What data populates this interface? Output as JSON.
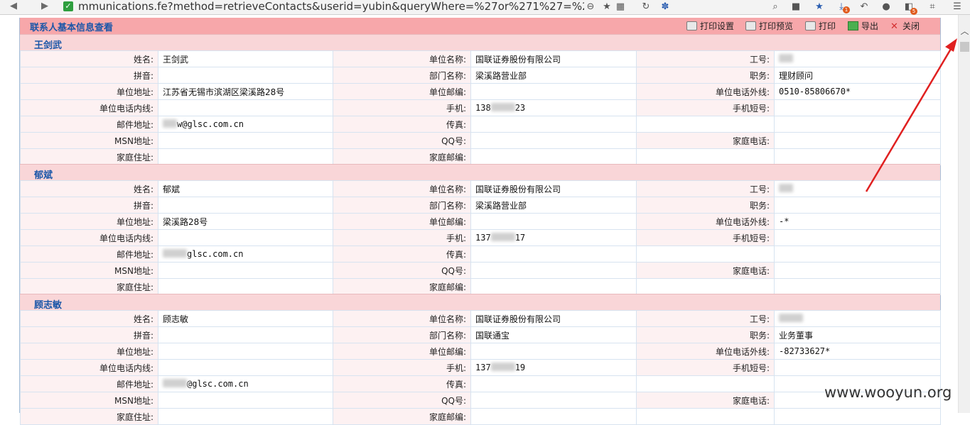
{
  "browser": {
    "url": "mmunications.fe?method=retrieveContacts&userid=yubin&queryWhere=%27or%271%27=%271",
    "badges": {
      "downloads": "1",
      "extension": "5"
    }
  },
  "panel": {
    "title": "联系人基本信息查看",
    "buttons": {
      "print_settings": "打印设置",
      "print_preview": "打印预览",
      "print": "打印",
      "export": "导出",
      "close": "关闭"
    }
  },
  "labels": {
    "name": "姓名:",
    "unit_name": "单位名称:",
    "job_no": "工号:",
    "pinyin": "拼音:",
    "dept": "部门名称:",
    "position": "职务:",
    "unit_addr": "单位地址:",
    "unit_zip": "单位邮编:",
    "unit_ext_phone": "单位电话外线:",
    "unit_int_phone": "单位电话内线:",
    "mobile": "手机:",
    "mobile_short": "手机短号:",
    "email": "邮件地址:",
    "fax": "传真:",
    "msn": "MSN地址:",
    "qq": "QQ号:",
    "home_phone": "家庭电话:",
    "home_addr": "家庭住址:",
    "home_zip": "家庭邮编:"
  },
  "contacts": [
    {
      "section": "王剑武",
      "name": "王剑武",
      "unit_name": "国联证券股份有限公司",
      "dept": "梁溪路营业部",
      "position": "理财顾问",
      "unit_addr": "江苏省无锡市滨湖区梁溪路28号",
      "unit_ext_phone": "0510-85806670*",
      "mobile_a": "138",
      "mobile_b": "23",
      "email_suffix": "w@glsc.com.cn"
    },
    {
      "section": "郁斌",
      "name": "郁斌",
      "unit_name": "国联证券股份有限公司",
      "dept": "梁溪路营业部",
      "position": "",
      "unit_addr": "梁溪路28号",
      "unit_ext_phone": "-*",
      "mobile_a": "137",
      "mobile_b": "17",
      "email_suffix": "glsc.com.cn"
    },
    {
      "section": "顾志敏",
      "name": "顾志敏",
      "unit_name": "国联证券股份有限公司",
      "dept": "国联通宝",
      "position": "业务董事",
      "unit_addr": "",
      "unit_ext_phone": "-82733627*",
      "mobile_a": "137",
      "mobile_b": "19",
      "email_suffix": "@glsc.com.cn"
    }
  ],
  "watermark": "www.wooyun.org",
  "colors": {
    "header_bg": "#f7a7aa",
    "section_bg": "#f9d6d8",
    "title_text": "#1a56a8",
    "annotation_arrow": "#e02020"
  }
}
